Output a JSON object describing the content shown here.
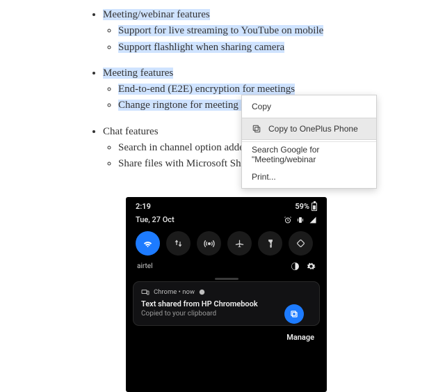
{
  "doc": {
    "section1": {
      "title": "Meeting/webinar features",
      "items": [
        "Support for live streaming to YouTube on mobile",
        "Support flashlight when sharing camera"
      ]
    },
    "section2": {
      "title": "Meeting features",
      "items": [
        "End-to-end (E2E) encryption for meetings",
        "Change ringtone for meeting in"
      ]
    },
    "section3": {
      "title": "Chat features",
      "items": [
        "Search in channel option added",
        "Share files with Microsoft Shar"
      ]
    }
  },
  "context_menu": {
    "copy": "Copy",
    "copy_to_phone": "Copy to OnePlus Phone",
    "search": "Search Google for \"Meeting/webinar",
    "print": "Print..."
  },
  "phone": {
    "status": {
      "time": "2:19",
      "battery_pct": "59%"
    },
    "date": "Tue, 27 Oct",
    "tiles_label": "airtel",
    "notification": {
      "app_line": "Chrome • now",
      "title": "Text shared from HP Chromebook",
      "subtitle": "Copied to your clipboard"
    },
    "manage": "Manage"
  }
}
